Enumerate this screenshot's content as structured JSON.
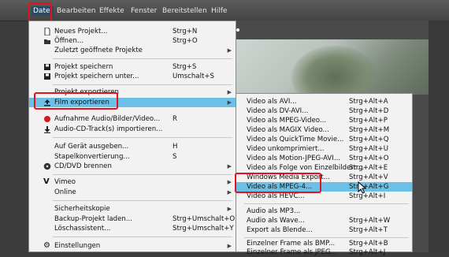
{
  "menubar": {
    "items": [
      "Datei",
      "Bearbeiten",
      "Effekte",
      "Fenster",
      "Bereitstellen",
      "Hilfe"
    ]
  },
  "file_menu": {
    "items": [
      {
        "label": "Neues Projekt...",
        "shortcut": "Strg+N",
        "icon": "new-document-icon"
      },
      {
        "label": "Öffnen...",
        "shortcut": "Strg+O",
        "icon": "open-folder-icon"
      },
      {
        "label": "Zuletzt geöffnete Projekte",
        "shortcut": "",
        "submenu": true
      },
      {
        "label": "Projekt speichern",
        "shortcut": "Strg+S",
        "icon": "save-icon"
      },
      {
        "label": "Projekt speichern unter...",
        "shortcut": "Umschalt+S",
        "icon": "save-as-icon"
      },
      {
        "label": "Projekt exportieren",
        "shortcut": "",
        "submenu": true
      },
      {
        "label": "Film exportieren",
        "shortcut": "",
        "submenu": true,
        "icon": "export-icon"
      },
      {
        "label": "Aufnahme Audio/Bilder/Video...",
        "shortcut": "R",
        "icon": "record-icon"
      },
      {
        "label": "Audio-CD-Track(s) importieren...",
        "shortcut": "",
        "icon": "import-icon"
      },
      {
        "label": "Auf Gerät ausgeben...",
        "shortcut": "H"
      },
      {
        "label": "Stapelkonvertierung...",
        "shortcut": "S"
      },
      {
        "label": "CD/DVD brennen",
        "shortcut": "",
        "submenu": true,
        "icon": "disc-icon"
      },
      {
        "label": "Vimeo",
        "shortcut": "",
        "submenu": true,
        "icon": "vimeo-icon"
      },
      {
        "label": "Online",
        "shortcut": "",
        "submenu": true
      },
      {
        "label": "Sicherheitskopie",
        "shortcut": "",
        "submenu": true
      },
      {
        "label": "Backup-Projekt laden...",
        "shortcut": "Strg+Umschalt+O"
      },
      {
        "label": "Löschassistent...",
        "shortcut": "Strg+Umschalt+Y"
      },
      {
        "label": "Einstellungen",
        "shortcut": "",
        "submenu": true,
        "icon": "gear-icon"
      }
    ]
  },
  "export_submenu": {
    "items": [
      {
        "label": "Video als AVI...",
        "shortcut": "Strg+Alt+A"
      },
      {
        "label": "Video als DV-AVI...",
        "shortcut": "Strg+Alt+D"
      },
      {
        "label": "Video als MPEG-Video...",
        "shortcut": "Strg+Alt+P"
      },
      {
        "label": "Video als MAGIX Video...",
        "shortcut": "Strg+Alt+M"
      },
      {
        "label": "Video als QuickTime Movie...",
        "shortcut": "Strg+Alt+Q"
      },
      {
        "label": "Video unkomprimiert...",
        "shortcut": "Strg+Alt+U"
      },
      {
        "label": "Video als Motion-JPEG-AVI...",
        "shortcut": "Strg+Alt+O"
      },
      {
        "label": "Video als Folge von Einzelbildern...",
        "shortcut": "Strg+Alt+E"
      },
      {
        "label": "Windows Media Export...",
        "shortcut": "Strg+Alt+V"
      },
      {
        "label": "Video als MPEG-4...",
        "shortcut": "Strg+Alt+G"
      },
      {
        "label": "Video als HEVC...",
        "shortcut": "Strg+Alt+I"
      },
      {
        "label": "Audio als MP3...",
        "shortcut": ""
      },
      {
        "label": "Audio als Wave...",
        "shortcut": "Strg+Alt+W"
      },
      {
        "label": "Export als Blende...",
        "shortcut": "Strg+Alt+T"
      },
      {
        "label": "Einzelner Frame als BMP...",
        "shortcut": "Strg+Alt+B"
      },
      {
        "label": "Einzelner Frame als JPEG...",
        "shortcut": "Strg+Alt+J"
      }
    ]
  },
  "colors": {
    "highlight": "#6cc0e6",
    "annotation": "#e3121c"
  }
}
